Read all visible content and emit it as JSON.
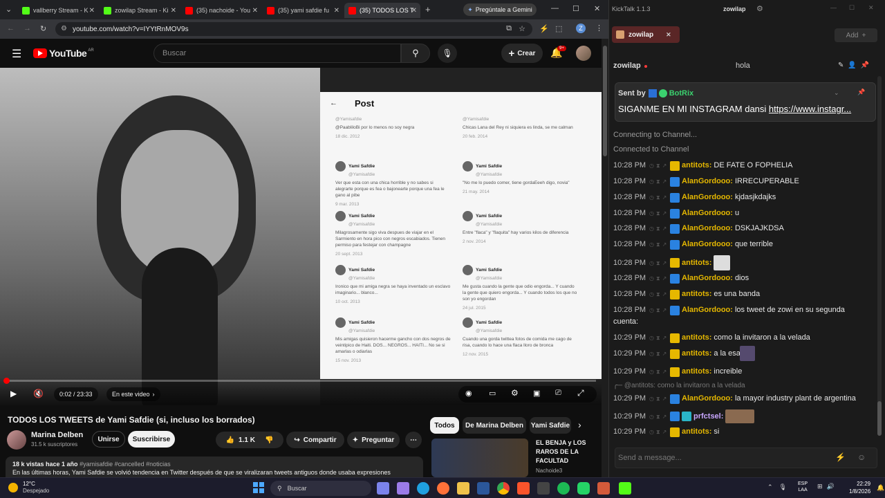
{
  "browser": {
    "tabs": [
      {
        "label": "vallberry Stream - K",
        "color": "#53fc18"
      },
      {
        "label": "zowilap Stream - Ki",
        "color": "#53fc18"
      },
      {
        "label": "(35) nachoide - You",
        "color": "#ff0000"
      },
      {
        "label": "(35) yami safdie fu",
        "color": "#ff0000"
      },
      {
        "label": "(35) TODOS LOS T",
        "color": "#ff0000"
      }
    ],
    "gemini_label": "Pregúntale a Gemini",
    "url": "youtube.com/watch?v=IYYtRnMOV9s",
    "profile_initial": "Z"
  },
  "youtube": {
    "logo_text": "YouTube",
    "logo_region": "AR",
    "search_placeholder": "Buscar",
    "create_label": "Crear",
    "notif_count": "9+",
    "player": {
      "time": "0:02 / 23:33",
      "chapter_label": "En este video",
      "progress_fraction": 0.0014
    },
    "post": {
      "header": "Post",
      "left_col": [
        {
          "handle": "@Yamisafdie",
          "text": "@PaabliloBi por lo menos no soy negra",
          "date": "18 dic. 2012"
        },
        {
          "name": "Yami Safdie",
          "handle": "@Yamisafdie",
          "text": "Ver que esta con una chica horrible y no sabes si alegrarte porque es fea o bajonearte porque una fea le gano al pibe",
          "date": "9 mar. 2013"
        },
        {
          "name": "Yami Safdie",
          "handle": "@Yamisafdie",
          "text": "Milagrosamente sigo viva despues de viajar en el Sarmiento en hora pico con negros escabiados. Tienen permiso para festejar con champagne",
          "date": "20 sept. 2013"
        },
        {
          "name": "Yami Safdie",
          "handle": "@Yamisafdie",
          "text": "Ironico que mi amiga negra se haya inventado un esclavo imaginario... blanco...",
          "date": "10 oct. 2013"
        },
        {
          "name": "Yami Safdie",
          "handle": "@Yamisafdie",
          "text": "Mis amigas quisieron hacerme gancho con dos negros de veintipico de Haiti. DOS... NEGROS... HAITI... No se si amarlas o odiarlas",
          "date": "15 nov. 2013"
        }
      ],
      "right_col": [
        {
          "handle": "@Yamisafdie",
          "text": "Chicas Lana del Rey ni siquiera es linda, se me calman",
          "date": "20 feb. 2014"
        },
        {
          "name": "Yami Safdie",
          "handle": "@Yamisafdie",
          "text": "\"No me lo puedo comer, tiene gordaEeeh digo, novia\"",
          "date": "21 may. 2014"
        },
        {
          "name": "Yami Safdie",
          "handle": "@Yamisafdie",
          "text": "Entre \"flaca\" y \"flaquita\" hay varios kilos de diferencia",
          "date": "2 nov. 2014"
        },
        {
          "name": "Yami Safdie",
          "handle": "@Yamisafdie",
          "text": "Me gusta cuando la gente que odio engorda... Y cuando la gente que quiero engorda... Y cuando todos los que no son yo engordan",
          "date": "24 jul. 2015"
        },
        {
          "name": "Yami Safdie",
          "handle": "@Yamisafdie",
          "text": "Cuando una gorda twittea fotos de comida me cago de risa, cuando lo hace una flaca lloro de bronca",
          "date": "12 nov. 2015"
        }
      ]
    },
    "title": "TODOS LOS TWEETS de Yami Safdie (si, incluso los borrados)",
    "channel": {
      "name": "Marina Delben",
      "subs": "31.5 k suscriptores"
    },
    "join_label": "Unirse",
    "subscribe_label": "Suscribirse",
    "likes": "1.1 K",
    "share_label": "Compartir",
    "ask_label": "Preguntar",
    "views_line": "18 k vistas  hace 1 año",
    "hashtags": "#yamisafdie #cancelled #noticias",
    "desc": "En las últimas horas, Yami Safdie se volvió tendencia en Twitter después de que se viralizaran tweets antiguos donde usaba expresiones",
    "chips": [
      "Todos",
      "De Marina Delben",
      "Yami Safdie"
    ],
    "reco": {
      "title_l1": "EL BENJA y LOS",
      "title_l2": "RAROS DE LA",
      "title_l3": "FACULTAD",
      "channel": "Nachoide3"
    }
  },
  "kicktalk": {
    "app_title": "KickTalk 1.1.3",
    "user": "zowilap",
    "tab_label": "zowilap",
    "add_label": "Add",
    "channel_label": "zowilap",
    "header_msg": "hola",
    "pinned_from": "Sent by",
    "pinned_bot": "BotRix",
    "pinned_text": "SIGANME EN MI INSTAGRAM dansi",
    "pinned_link": "https://www.instagr...",
    "sys1": "Connecting to Channel...",
    "sys2": "Connected to Channel",
    "reply_context": "@antitots: como la invitaron a la velada",
    "input_placeholder": "Send a message...",
    "messages": [
      {
        "time": "10:28 PM",
        "user": "antitots:",
        "text": "DE FATE O FOPHELIA",
        "color": "#e6b800"
      },
      {
        "time": "10:28 PM",
        "user": "AlanGordooo:",
        "text": "IRRECUPERABLE",
        "color": "#e6b800"
      },
      {
        "time": "10:28 PM",
        "user": "AlanGordooo:",
        "text": "kjdasjkdajks",
        "color": "#e6b800"
      },
      {
        "time": "10:28 PM",
        "user": "AlanGordooo:",
        "text": "u",
        "color": "#e6b800"
      },
      {
        "time": "10:28 PM",
        "user": "AlanGordooo:",
        "text": "DSKJAJKDSA",
        "color": "#e6b800"
      },
      {
        "time": "10:28 PM",
        "user": "AlanGordooo:",
        "text": "que terrible",
        "color": "#e6b800"
      },
      {
        "time": "10:28 PM",
        "user": "antitots:",
        "text": "",
        "color": "#e6b800"
      },
      {
        "time": "10:28 PM",
        "user": "AlanGordooo:",
        "text": "dios",
        "color": "#e6b800"
      },
      {
        "time": "10:28 PM",
        "user": "antitots:",
        "text": "es una banda",
        "color": "#e6b800"
      },
      {
        "time": "10:28 PM",
        "user": "AlanGordooo:",
        "text": "los tweet de zowi en su segunda",
        "color": "#e6b800"
      },
      {
        "time": "",
        "user": "",
        "text": "cuenta:",
        "color": "#e6b800"
      },
      {
        "time": "10:29 PM",
        "user": "antitots:",
        "text": "como la invitaron a la velada",
        "color": "#e6b800"
      },
      {
        "time": "10:29 PM",
        "user": "antitots:",
        "text": "a la       esa",
        "color": "#e6b800"
      },
      {
        "time": "10:29 PM",
        "user": "antitots:",
        "text": "increible",
        "color": "#e6b800"
      },
      {
        "time": "10:29 PM",
        "user": "AlanGordooo:",
        "text": "la mayor industry plant de argentina",
        "color": "#e6b800"
      },
      {
        "time": "10:29 PM",
        "user": "prfctsel:",
        "text": "",
        "color": "#c9a7ff"
      },
      {
        "time": "10:29 PM",
        "user": "antitots:",
        "text": "si",
        "color": "#e6b800"
      }
    ]
  },
  "taskbar": {
    "weather_temp": "12°C",
    "weather_desc": "Despejado",
    "search_placeholder": "Buscar",
    "lang_l1": "ESP",
    "lang_l2": "LAA",
    "time": "22:29",
    "date": "1/8/2026"
  }
}
